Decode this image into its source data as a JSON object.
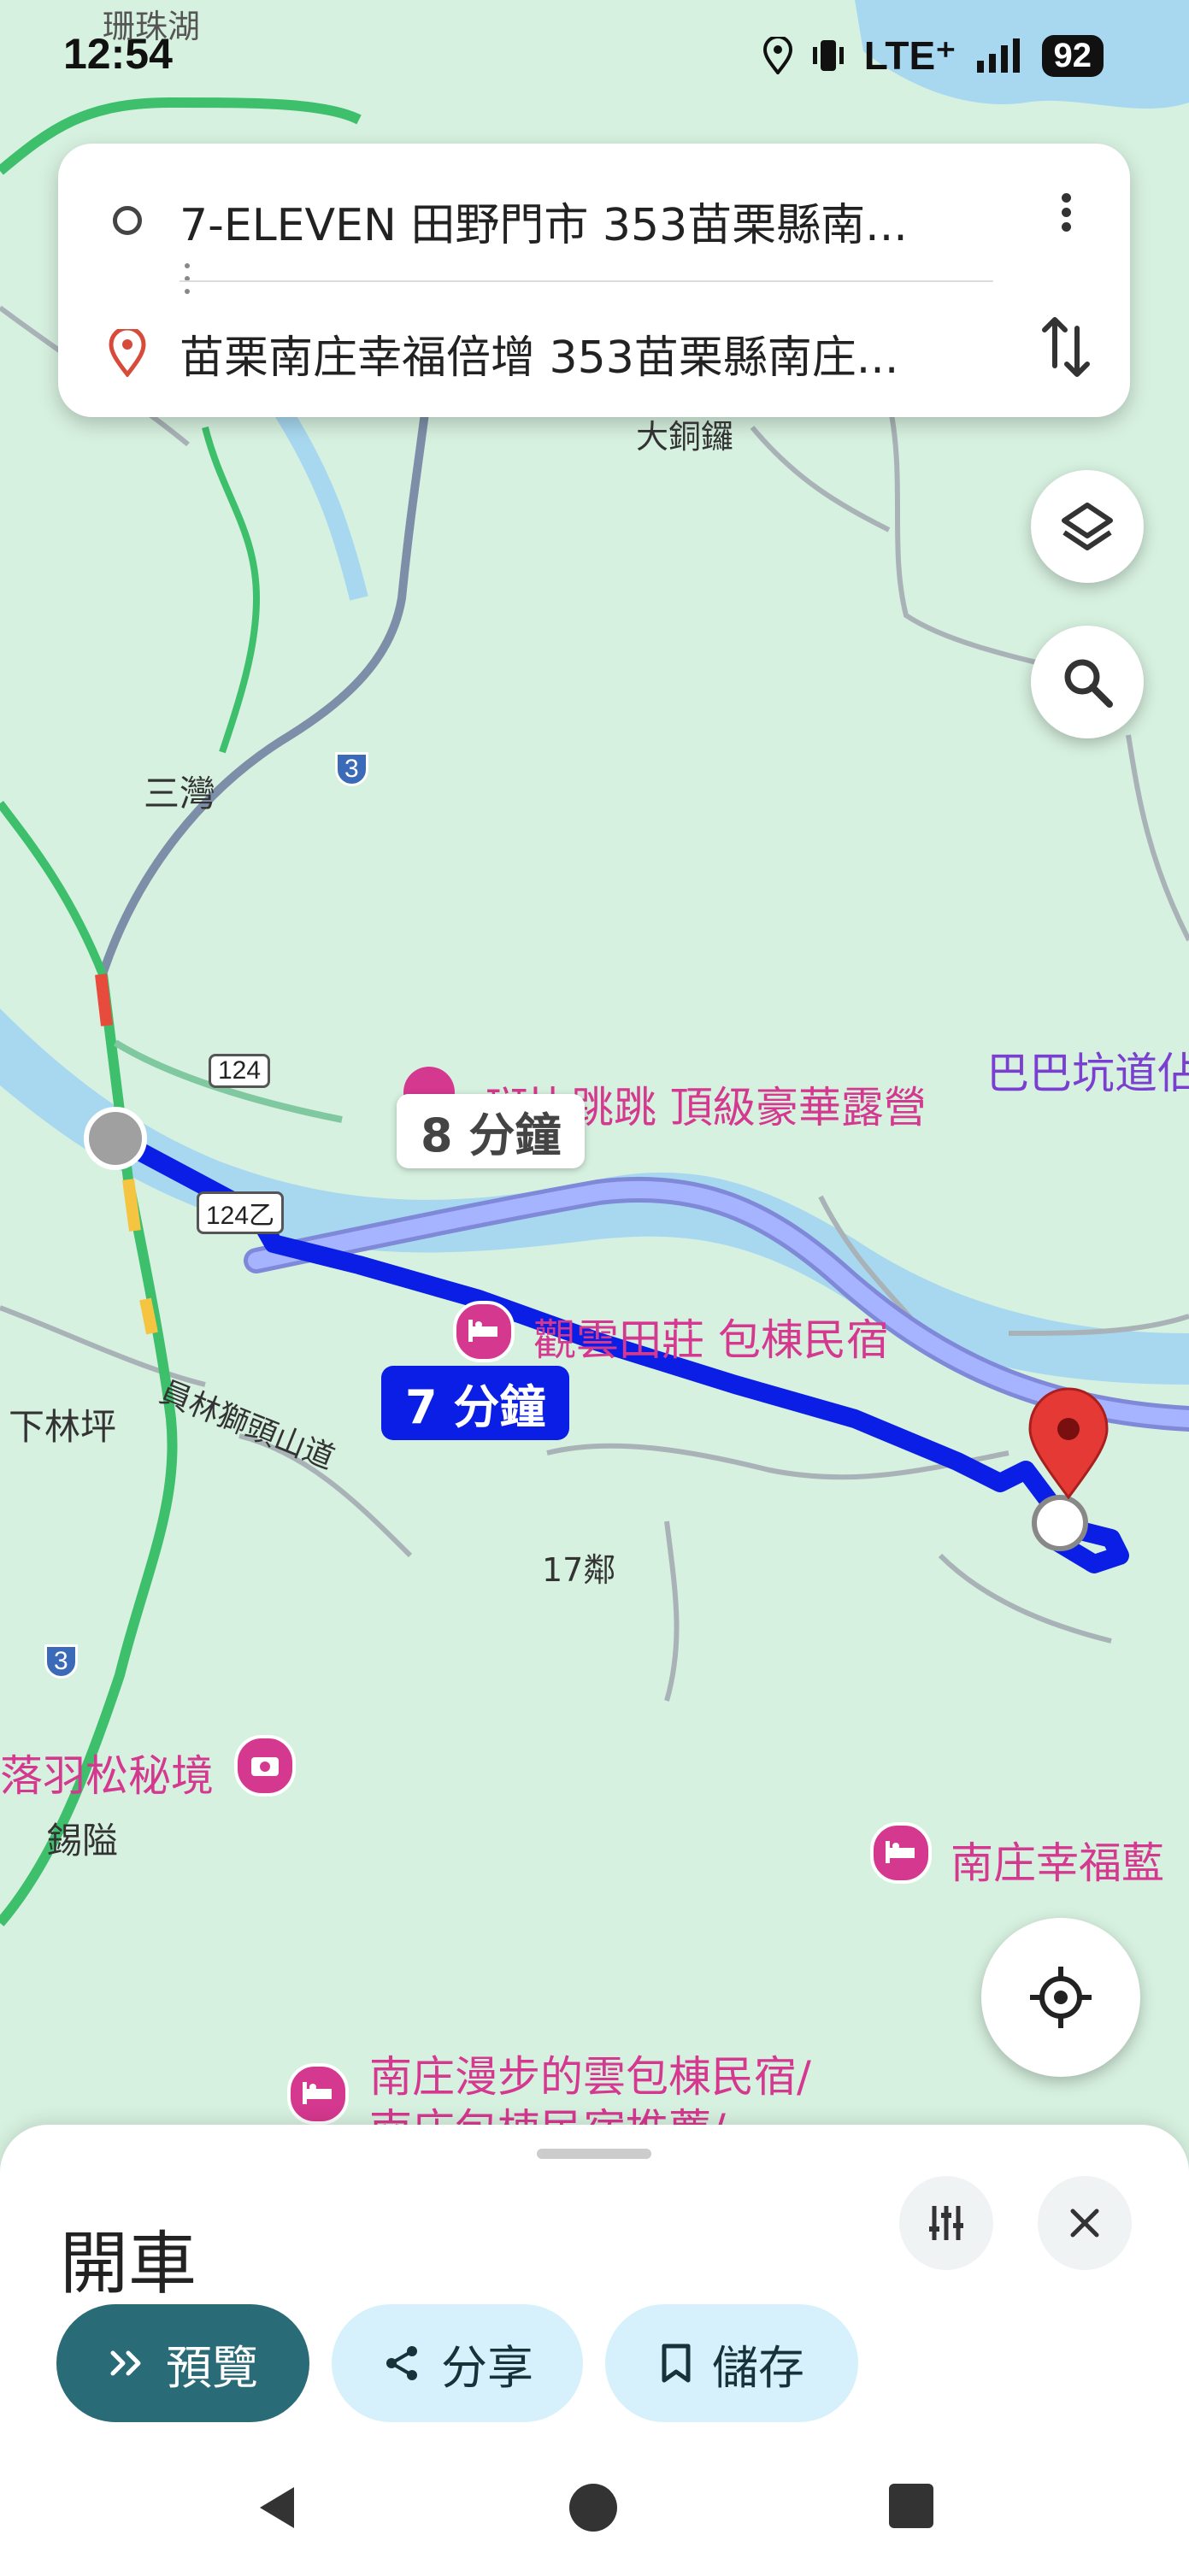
{
  "status_bar": {
    "time": "12:54",
    "network": "LTE⁺",
    "battery": "92"
  },
  "directions": {
    "origin": "7-ELEVEN 田野門市 353苗栗縣南...",
    "destination": "苗栗南庄幸福倍增 353苗栗縣南庄...",
    "origin_icon": "circle-icon",
    "destination_icon": "location-pin-icon",
    "more_icon": "more-vert-icon",
    "swap_icon": "swap-vert-icon"
  },
  "map": {
    "colors": {
      "land": "#d7f1e0",
      "water": "#a8d8f0",
      "route_primary": "#0a1ee6",
      "route_alt": "#a6b4ff",
      "highway": "#3dbf6b",
      "poi": "#d5388f"
    },
    "route_primary_time": "7 分鐘",
    "route_alt_time": "8 分鐘",
    "places": {
      "sanwan": "三灣",
      "xialinping": "下林坪",
      "xiling": "錫隘",
      "dadongluo": "大銅鑼",
      "neighborhood_17": "17鄰",
      "road_name": "員林獅頭山道",
      "top_left_partial": "珊珠湖",
      "right_partial": "巴巴坑道佔"
    },
    "road_shields": {
      "r124": "124",
      "r124b": "124乙",
      "r3a": "3",
      "r3b": "3"
    },
    "pois": {
      "camping": "斑比跳跳 頂級豪華露營",
      "guanyun": "觀雲田莊 包棟民宿",
      "luoyu": "落羽松秘境",
      "nanzhuang_happy": "南庄幸福藍",
      "nanzhuang_walk_1": "南庄漫步的雲包棟民宿/",
      "nanzhuang_walk_2": "南庄包棟民宿推薦/"
    },
    "buttons": {
      "layers_icon": "layers-icon",
      "search_icon": "search-icon",
      "my_location_icon": "my-location-icon"
    }
  },
  "bottom_sheet": {
    "mode_title": "開車",
    "options_icon": "tune-icon",
    "close_icon": "close-icon",
    "buttons": {
      "preview": "預覽",
      "share": "分享",
      "save": "儲存"
    }
  },
  "nav_bar": {
    "back_icon": "back-triangle-icon",
    "home_icon": "home-circle-icon",
    "recents_icon": "recents-square-icon"
  }
}
